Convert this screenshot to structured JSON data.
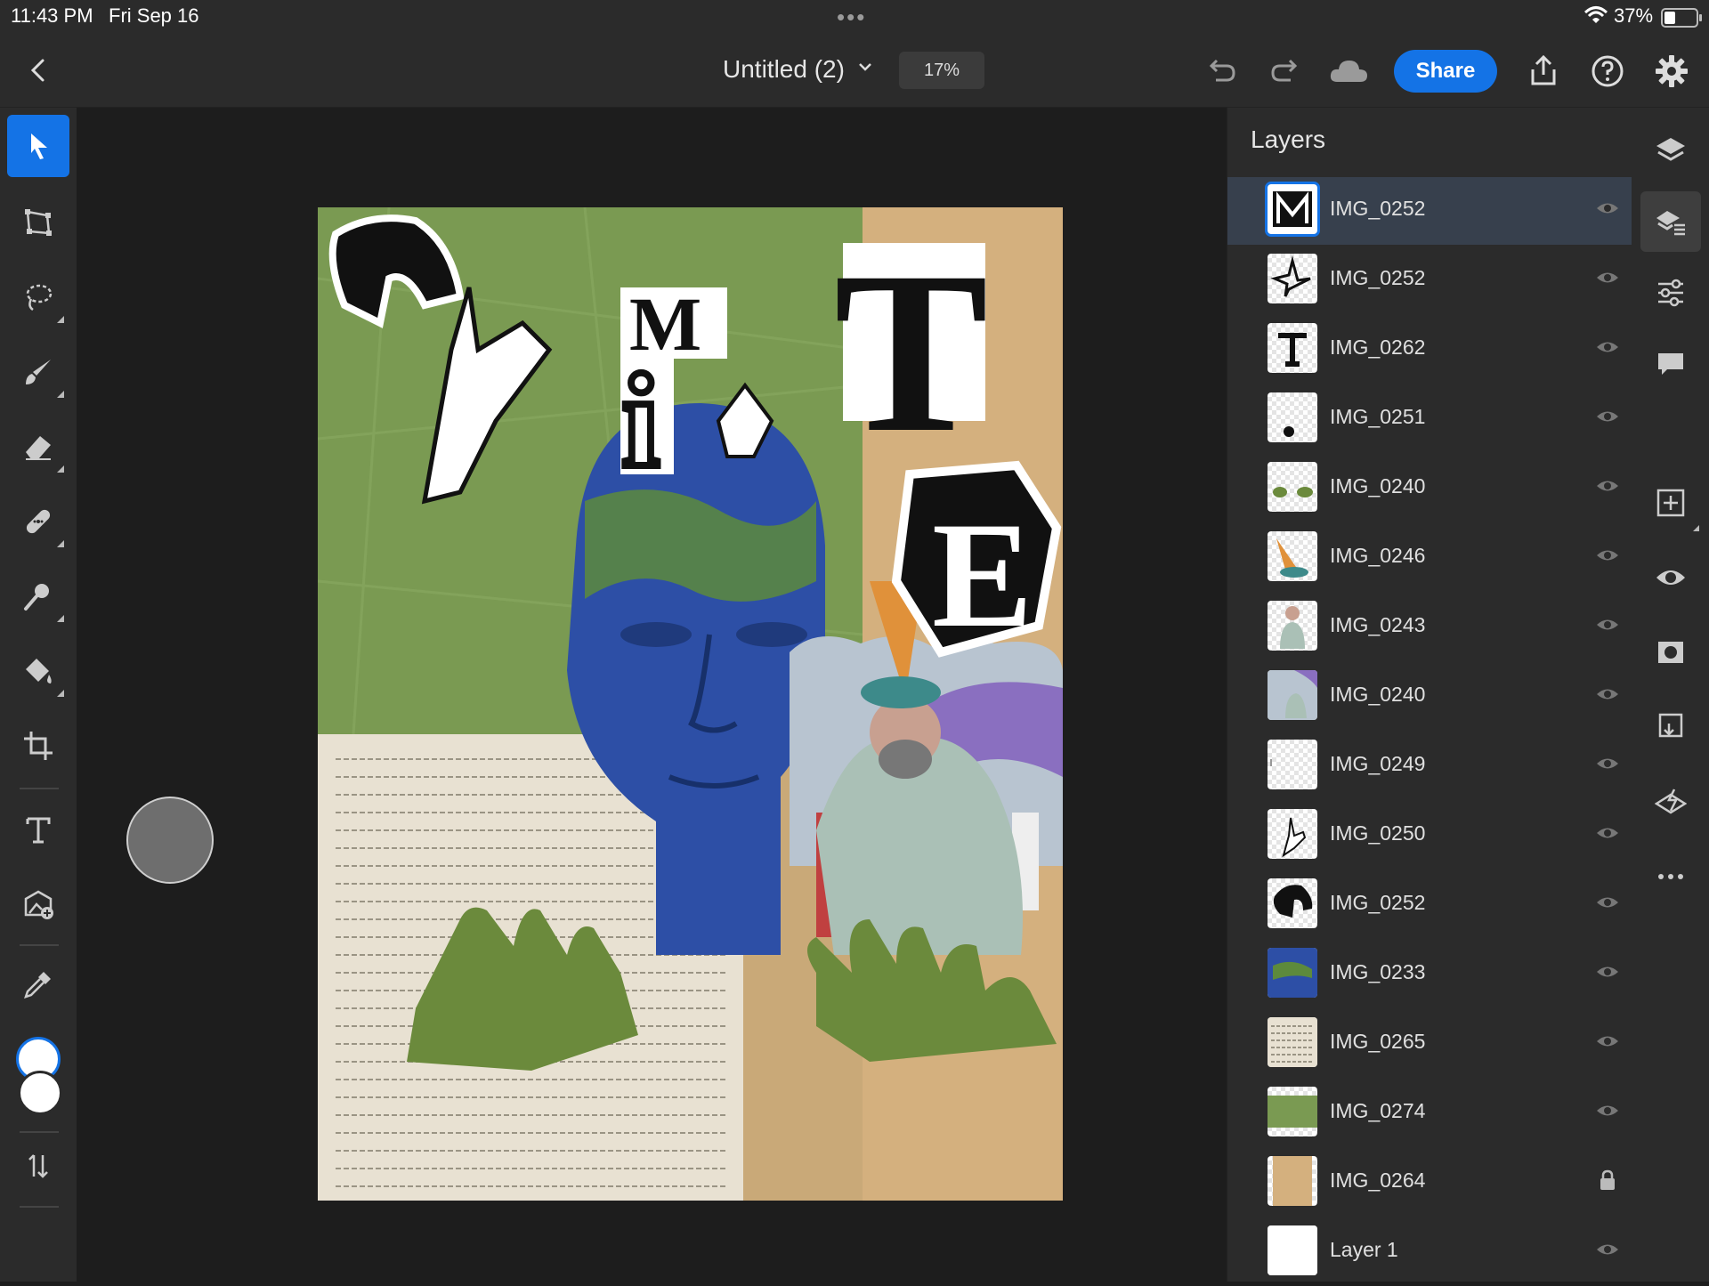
{
  "status": {
    "time": "11:43 PM",
    "date": "Fri Sep 16",
    "battery": "37%"
  },
  "topbar": {
    "title": "Untitled (2)",
    "zoom": "17%",
    "share_label": "Share"
  },
  "colors": {
    "accent": "#1473e6",
    "bg": "#1d1d1d",
    "panel": "#2b2b2b",
    "selected_row": "#37404d"
  },
  "tools": [
    "select-tool",
    "transform-tool",
    "lasso-tool",
    "brush-tool",
    "eraser-tool",
    "healing-tool",
    "smudge-tool",
    "fill-tool",
    "crop-tool",
    "type-tool",
    "place-image-tool",
    "eyedropper-tool",
    "color-swatch",
    "swap-colors"
  ],
  "layers": {
    "title": "Layers",
    "items": [
      {
        "name": "IMG_0252",
        "selected": true
      },
      {
        "name": "IMG_0252"
      },
      {
        "name": "IMG_0262"
      },
      {
        "name": "IMG_0251"
      },
      {
        "name": "IMG_0240"
      },
      {
        "name": "IMG_0246"
      },
      {
        "name": "IMG_0243"
      },
      {
        "name": "IMG_0240"
      },
      {
        "name": "IMG_0249"
      },
      {
        "name": "IMG_0250"
      },
      {
        "name": "IMG_0252"
      },
      {
        "name": "IMG_0233"
      },
      {
        "name": "IMG_0265"
      },
      {
        "name": "IMG_0274"
      },
      {
        "name": "IMG_0264",
        "locked": true
      },
      {
        "name": "Layer 1"
      }
    ]
  },
  "artwork": {
    "letters": [
      "M",
      "i",
      "T",
      "E"
    ]
  }
}
